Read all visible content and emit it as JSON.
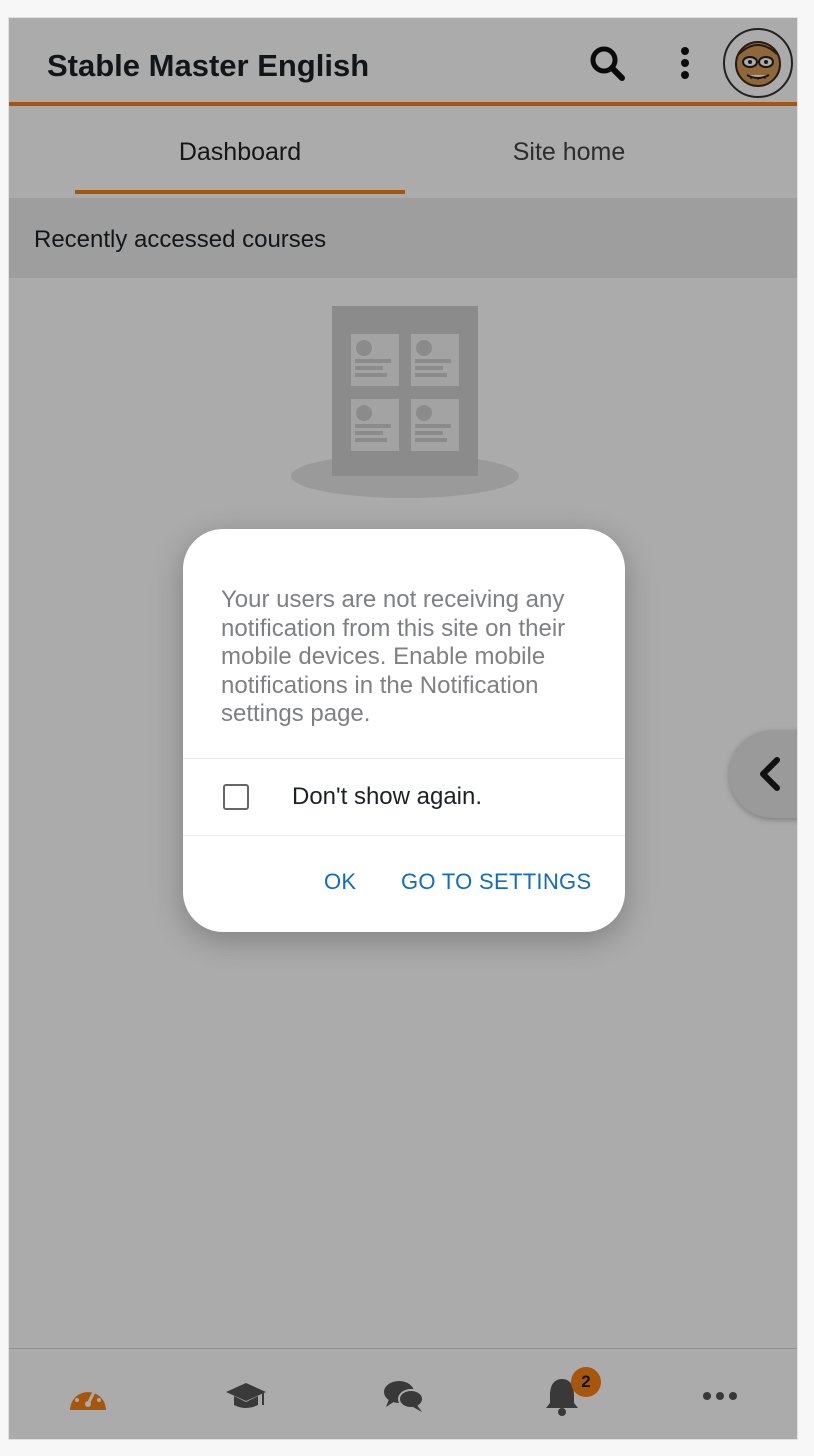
{
  "header": {
    "title": "Stable Master English",
    "icons": [
      "search-icon",
      "kebab-menu-icon",
      "user-avatar"
    ]
  },
  "tabs": [
    {
      "label": "Dashboard",
      "active": true
    },
    {
      "label": "Site home",
      "active": false
    }
  ],
  "section": {
    "title": "Recently accessed courses"
  },
  "dialog": {
    "message": "Your users are not receiving any notification from this site on their mobile devices. Enable mobile notifications in the Notification settings page.",
    "checkbox_label": "Don't show again.",
    "checkbox_checked": false,
    "ok_label": "OK",
    "settings_label": "GO TO SETTINGS"
  },
  "tabbar": {
    "items": [
      {
        "icon": "dashboard-gauge-icon",
        "active": true
      },
      {
        "icon": "graduation-cap-icon",
        "active": false
      },
      {
        "icon": "chat-bubbles-icon",
        "active": false
      },
      {
        "icon": "bell-icon",
        "active": false,
        "badge": "2"
      },
      {
        "icon": "more-dots-icon",
        "active": false
      }
    ]
  },
  "colors": {
    "accent": "#f98012",
    "link": "#0f6cbf",
    "text": "#1d2125",
    "muted": "#7f8083"
  }
}
